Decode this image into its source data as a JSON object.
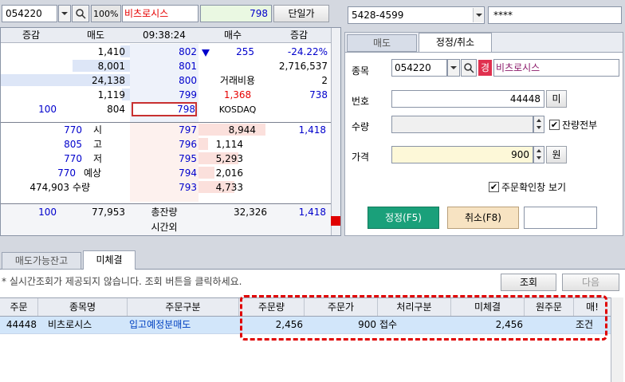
{
  "toolbar": {
    "code": "054220",
    "zoom": "100%",
    "name": "비츠로시스",
    "price": "798",
    "unit_label": "단일가"
  },
  "account": {
    "number": "5428-4599",
    "password": "****"
  },
  "orderbook": {
    "headers": [
      "증감",
      "매도",
      "09:38:24",
      "매수",
      "증감"
    ],
    "ask_rows": [
      {
        "qty": "1,410",
        "price": "802",
        "right": "255",
        "rate": "-24.22%"
      },
      {
        "qty": "8,001",
        "price": "801",
        "right": "",
        "rate": "2,716,537"
      },
      {
        "qty": "24,138",
        "price": "800",
        "right": "거래비용",
        "rate": "2"
      },
      {
        "qty": "1,119",
        "price": "799",
        "right": "1,368",
        "rate": "738"
      },
      {
        "chg": "100",
        "qty": "804",
        "price": "798",
        "right": "KOSDAQ",
        "rate": ""
      }
    ],
    "bid_rows": [
      {
        "label": "시",
        "lval": "770",
        "price": "797",
        "qty": "8,944",
        "chg": "1,418"
      },
      {
        "label": "고",
        "lval": "805",
        "price": "796",
        "qty": "1,114",
        "chg": ""
      },
      {
        "label": "저",
        "lval": "770",
        "price": "795",
        "qty": "5,293",
        "chg": ""
      },
      {
        "label": "예상",
        "lval": "770",
        "price": "794",
        "qty": "2,016",
        "chg": ""
      },
      {
        "label": "수량",
        "lval": "474,903",
        "price": "793",
        "qty": "4,733",
        "chg": ""
      }
    ],
    "footer": {
      "left_chg": "100",
      "ask_total": "77,953",
      "label1": "총잔량",
      "label2": "시간외",
      "bid_total": "32,326",
      "right_chg": "1,418"
    }
  },
  "order_panel": {
    "tabs": [
      "매도",
      "정정/취소"
    ],
    "active_tab": 1,
    "fields": {
      "item_label": "종목",
      "item_code": "054220",
      "item_badge": "경",
      "item_name": "비츠로시스",
      "no_label": "번호",
      "no_value": "44448",
      "no_btn": "미",
      "qty_label": "수량",
      "qty_check": "잔량전부",
      "price_label": "가격",
      "price_value": "900",
      "price_unit": "원",
      "confirm_check": "주문확인창 보기"
    },
    "buttons": {
      "submit": "정정(F5)",
      "cancel": "취소(F8)"
    }
  },
  "bottom": {
    "tabs": [
      "매도가능잔고",
      "미체결"
    ],
    "active_tab": 1,
    "notice": "* 실시간조회가 제공되지 않습니다. 조회 버튼을 클릭하세요.",
    "query_btn": "조회",
    "next_btn": "다음",
    "columns": [
      "주문",
      "종목명",
      "주문구분",
      "주문량",
      "주문가",
      "처리구분",
      "미체결",
      "원주문",
      "매!"
    ],
    "rows": [
      [
        "44448",
        "비츠로시스",
        "입고예정분매도",
        "2,456",
        "900",
        "접수",
        "2,456",
        "",
        "조건"
      ]
    ]
  },
  "colors": {
    "highlight_border": "#e00000",
    "submit_bg": "#1aa07a",
    "cancel_bg": "#f7e3c2",
    "bid_bar": "#fbe0dc",
    "ask_bar": "#dde6f7",
    "selected_row": "#d2e6fa"
  }
}
